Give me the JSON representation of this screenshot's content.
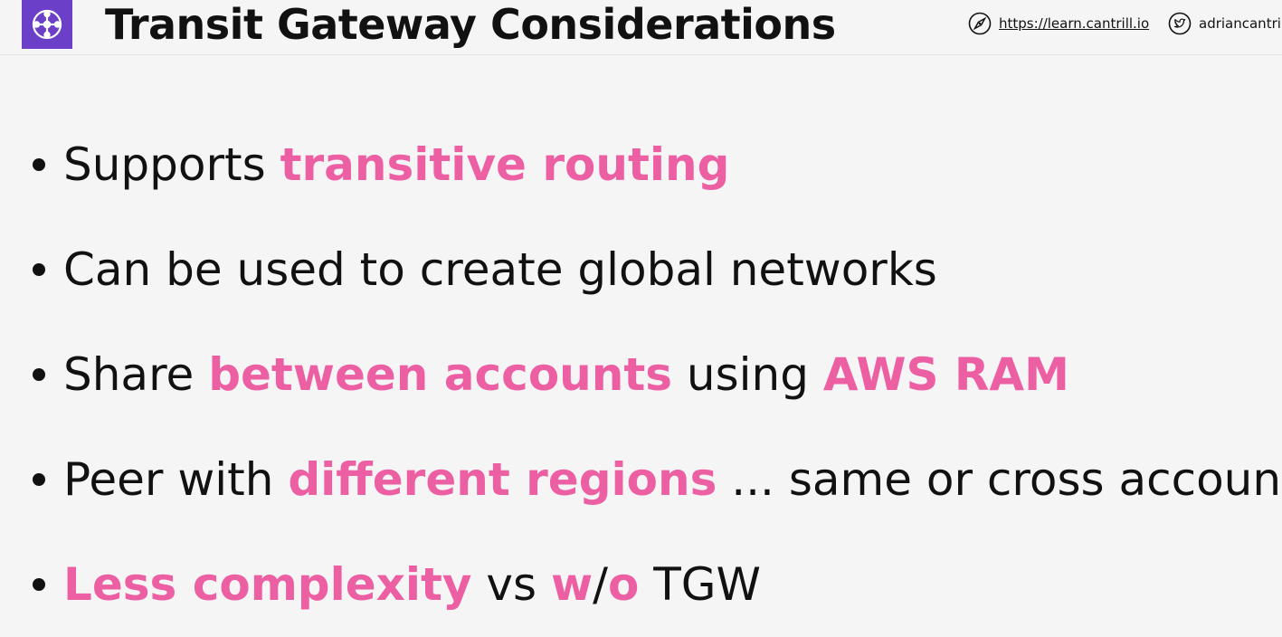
{
  "header": {
    "title": "Transit Gateway Considerations",
    "logo_icon": "transit-gateway-icon",
    "site_icon": "compass-icon",
    "site_url": "https://learn.cantrill.io",
    "twitter_icon": "twitter-icon",
    "twitter_handle": "adriancantril"
  },
  "colors": {
    "accent": "#ec5fa3",
    "logo_bg": "#6c3fc9",
    "text": "#111111",
    "background": "#f5f5f5"
  },
  "bullets": [
    {
      "segments": [
        {
          "text": "Supports ",
          "highlight": false
        },
        {
          "text": "transitive routing",
          "highlight": true
        }
      ]
    },
    {
      "segments": [
        {
          "text": "Can be used to create global networks",
          "highlight": false
        }
      ]
    },
    {
      "segments": [
        {
          "text": "Share ",
          "highlight": false
        },
        {
          "text": "between accounts",
          "highlight": true
        },
        {
          "text": " using ",
          "highlight": false
        },
        {
          "text": "AWS RAM",
          "highlight": true
        }
      ]
    },
    {
      "segments": [
        {
          "text": "Peer with ",
          "highlight": false
        },
        {
          "text": "different regions",
          "highlight": true
        },
        {
          "text": " ... same or cross account",
          "highlight": false
        }
      ]
    },
    {
      "segments": [
        {
          "text": "Less complexity",
          "highlight": true
        },
        {
          "text": " vs ",
          "highlight": false
        },
        {
          "text": "w",
          "highlight": true
        },
        {
          "text": "/",
          "highlight": false
        },
        {
          "text": "o",
          "highlight": true
        },
        {
          "text": " TGW",
          "highlight": false
        }
      ]
    }
  ]
}
